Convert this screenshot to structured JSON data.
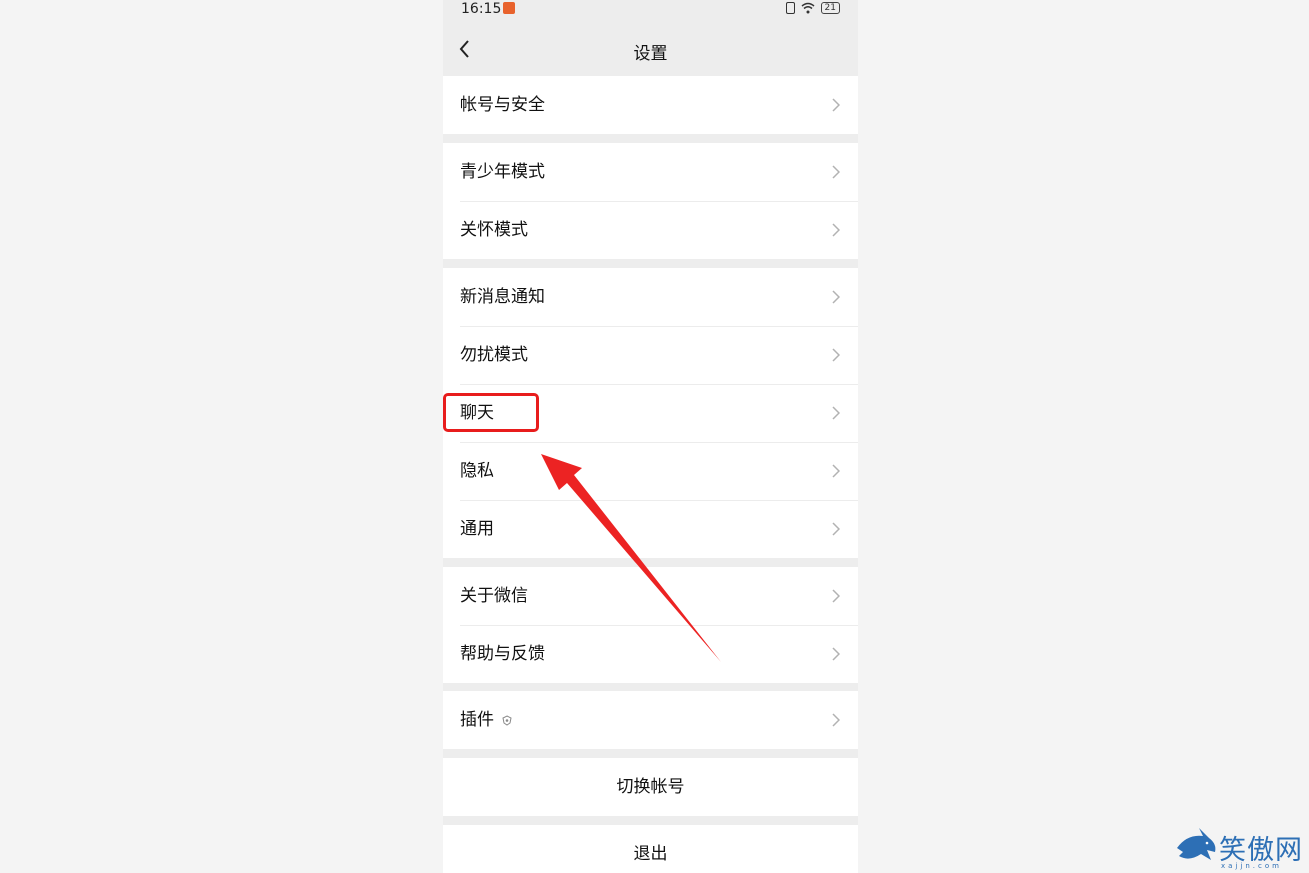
{
  "status_bar": {
    "time": "16:15",
    "battery": "21"
  },
  "nav": {
    "title": "设置"
  },
  "groups": [
    {
      "items": [
        {
          "label": "帐号与安全"
        }
      ]
    },
    {
      "items": [
        {
          "label": "青少年模式"
        },
        {
          "label": "关怀模式"
        }
      ]
    },
    {
      "items": [
        {
          "label": "新消息通知"
        },
        {
          "label": "勿扰模式"
        },
        {
          "label": "聊天"
        },
        {
          "label": "隐私"
        },
        {
          "label": "通用"
        }
      ]
    },
    {
      "items": [
        {
          "label": "关于微信"
        },
        {
          "label": "帮助与反馈"
        }
      ]
    },
    {
      "items": [
        {
          "label": "插件"
        }
      ]
    }
  ],
  "buttons": {
    "switch_account": "切换帐号",
    "logout": "退出"
  },
  "watermark": {
    "name": "笑傲网",
    "url": "xajjn.com"
  },
  "colors": {
    "highlight": "#e81c1c",
    "background": "#ededed",
    "watermark": "#2d6fb5"
  }
}
